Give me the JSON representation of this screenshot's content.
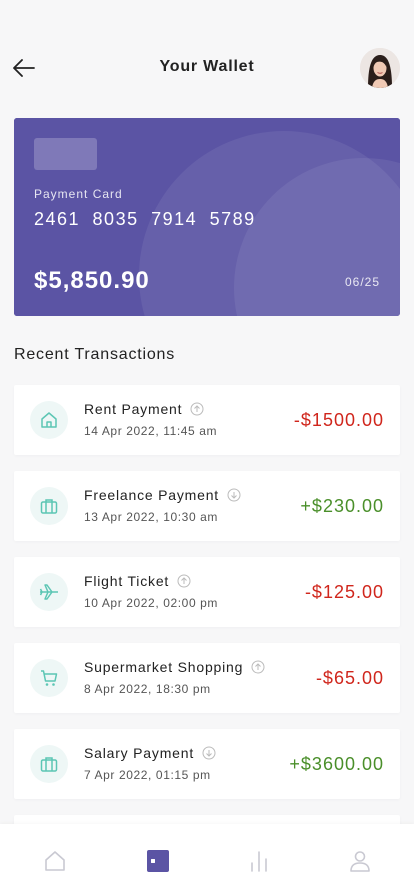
{
  "header": {
    "title": "Your Wallet"
  },
  "card": {
    "label": "Payment Card",
    "number": "2461 8035 7914 5789",
    "balance": "$5,850.90",
    "expiry": "06/25"
  },
  "section_title": "Recent Transactions",
  "transactions": [
    {
      "name": "Rent Payment",
      "date": "14 Apr 2022, 11:45 am",
      "amount": "-$1500.00",
      "icon": "home-icon",
      "direction": "outgoing"
    },
    {
      "name": "Freelance Payment",
      "date": "13 Apr 2022, 10:30 am",
      "amount": "+$230.00",
      "icon": "briefcase-icon",
      "direction": "incoming"
    },
    {
      "name": "Flight Ticket",
      "date": "10 Apr 2022, 02:00 pm",
      "amount": "-$125.00",
      "icon": "airplane-icon",
      "direction": "outgoing"
    },
    {
      "name": "Supermarket Shopping",
      "date": "8 Apr 2022, 18:30 pm",
      "amount": "-$65.00",
      "icon": "cart-icon",
      "direction": "outgoing"
    },
    {
      "name": "Salary Payment",
      "date": "7 Apr 2022, 01:15 pm",
      "amount": "+$3600.00",
      "icon": "briefcase-icon",
      "direction": "incoming"
    }
  ],
  "bottom_nav": {
    "items": [
      {
        "name": "home-icon",
        "active": false
      },
      {
        "name": "wallet-icon",
        "active": true
      },
      {
        "name": "stats-icon",
        "active": false
      },
      {
        "name": "profile-icon",
        "active": false
      }
    ]
  },
  "colors": {
    "card": "#5b54a4",
    "accent": "#5b54a4",
    "teal_icon": "#5cc6b4",
    "negative": "#d0261c",
    "positive": "#4a8f2a"
  }
}
